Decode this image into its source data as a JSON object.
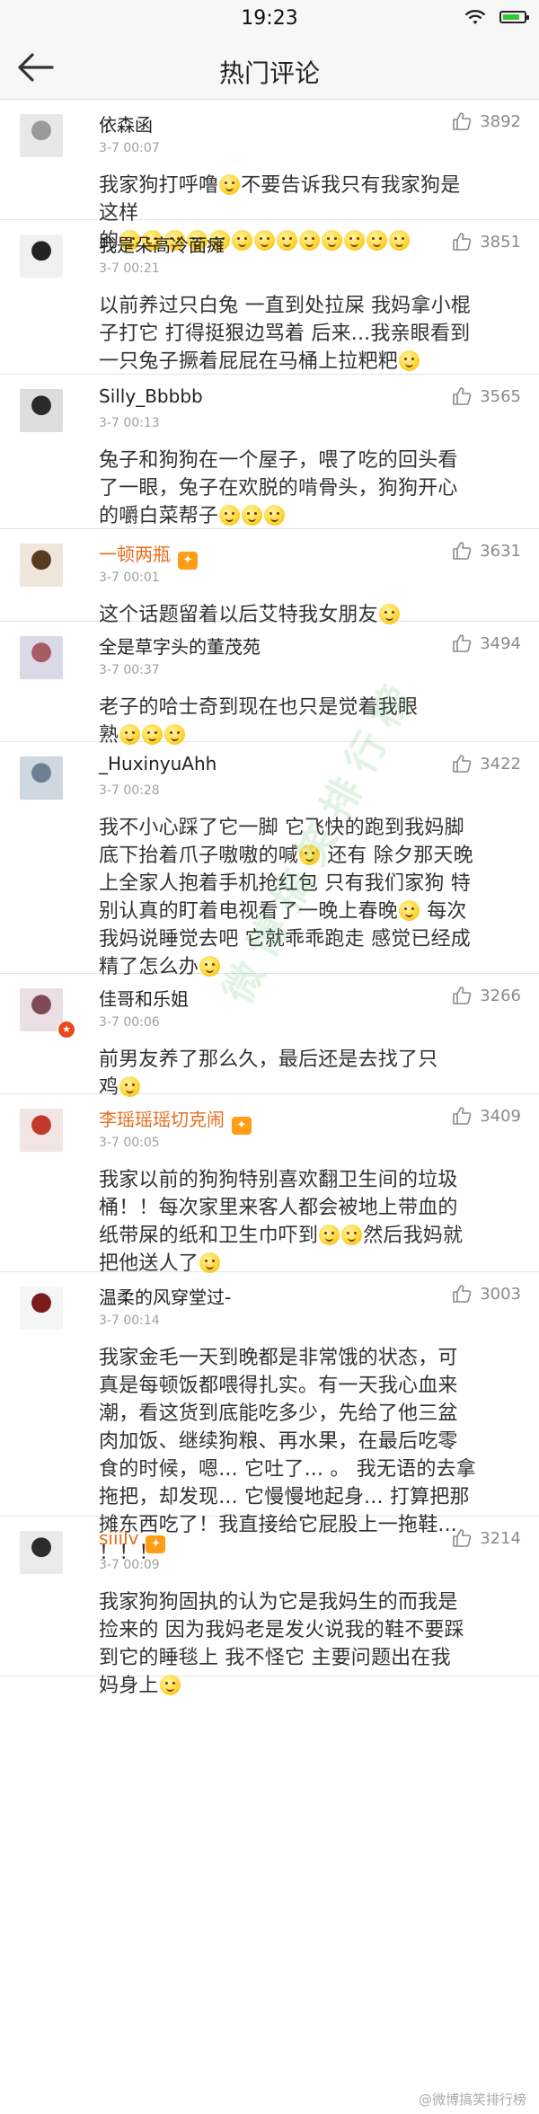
{
  "status": {
    "time": "19:23"
  },
  "nav": {
    "title": "热门评论"
  },
  "comments": [
    {
      "user": "依森函",
      "time": "3-7 00:07",
      "likes": "3892",
      "lines": [
        "我家狗打呼噜<e>不要告诉我只有我家狗是",
        "这样",
        "的<e><e><e><e><e><e><e><e><e><e><e><e><e>"
      ]
    },
    {
      "user": "我是朵高冷面瘫",
      "time": "3-7 00:21",
      "likes": "3851",
      "lines": [
        "以前养过只白兔 一直到处拉屎 我妈拿小棍",
        "子打它 打得挺狠边骂着 后来...我亲眼看到",
        "一只兔子撅着屁屁在马桶上拉粑粑<e>"
      ]
    },
    {
      "user": "Silly_Bbbbb",
      "time": "3-7 00:13",
      "likes": "3565",
      "lines": [
        "兔子和狗狗在一个屋子，喂了吃的回头看",
        "了一眼，兔子在欢脱的啃骨头，狗狗开心",
        "的嚼白菜帮子<e><e><e>"
      ]
    },
    {
      "user": "一顿两瓶",
      "time": "3-7 00:01",
      "likes": "3631",
      "vip": true,
      "lines": [
        "这个话题留着以后艾特我女朋友<e>"
      ]
    },
    {
      "user": "全是草字头的董茂苑",
      "time": "3-7 00:37",
      "likes": "3494",
      "lines": [
        "老子的哈士奇到现在也只是觉着我眼",
        "熟<e><e><e>"
      ]
    },
    {
      "user": "_HuxinyuAhh",
      "time": "3-7 00:28",
      "likes": "3422",
      "lines": [
        "我不小心踩了它一脚 它飞快的跑到我妈脚",
        "底下抬着爪子嗷嗷的喊<e> 还有 除夕那天晚",
        "上全家人抱着手机抢红包 只有我们家狗 特",
        "别认真的盯着电视看了一晚上春晚<e> 每次",
        "我妈说睡觉去吧 它就乖乖跑走 感觉已经成",
        "精了怎么办<e>"
      ]
    },
    {
      "user": "佳哥和乐姐",
      "time": "3-7 00:06",
      "likes": "3266",
      "badge": true,
      "lines": [
        "前男友养了那么久，最后还是去找了只",
        "鸡<e>"
      ]
    },
    {
      "user": "李瑶瑶瑶切克闹",
      "time": "3-7 00:05",
      "likes": "3409",
      "vip": true,
      "lines": [
        "我家以前的狗狗特别喜欢翻卫生间的垃圾",
        "桶！！每次家里来客人都会被地上带血的",
        "纸带屎的纸和卫生巾吓到<e><e>然后我妈就",
        "把他送人了<e>"
      ]
    },
    {
      "user": "温柔的风穿堂过-",
      "time": "3-7 00:14",
      "likes": "3003",
      "lines": [
        "我家金毛一天到晚都是非常饿的状态，可",
        "真是每顿饭都喂得扎实。有一天我心血来",
        "潮，看这货到底能吃多少，先给了他三盆",
        "肉加饭、继续狗粮、再水果，在最后吃零",
        "食的时候，嗯...  它吐了...  。  我无语的去拿",
        "拖把，却发现... 它慢慢地起身... 打算把那",
        "摊东西吃了！我直接给它屁股上一拖鞋...",
        "！！！"
      ]
    },
    {
      "user": "siiilv",
      "time": "3-7 00:09",
      "likes": "3214",
      "vip": true,
      "lines": [
        "我家狗狗固执的认为它是我妈生的而我是",
        "捡来的  因为我妈老是发火说我的鞋不要踩",
        "到它的睡毯上   我不怪它  主要问题出在我",
        "妈身上<e>"
      ]
    }
  ],
  "watermark": "微博搞笑排行榜",
  "footer": "@微博搞笑排行榜"
}
